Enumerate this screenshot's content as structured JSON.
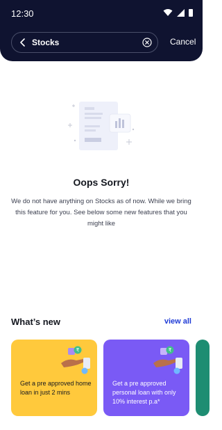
{
  "status_bar": {
    "time": "12:30"
  },
  "search": {
    "query": "Stocks",
    "cancel_label": "Cancel"
  },
  "empty_state": {
    "title": "Oops Sorry!",
    "description": "We do not have anything on Stocks as of now. While we bring this feature for you. See below some new features that you might like"
  },
  "whats_new": {
    "title": "What’s new",
    "view_all_label": "view all",
    "cards": [
      {
        "text": "Get a pre approved home loan in just 2 mins",
        "color": "#ffc93c"
      },
      {
        "text": "Get a pre approved personal loan with only 10% interest p.a*",
        "color": "#7a5af5"
      }
    ]
  },
  "colors": {
    "header": "#0f1330",
    "accent": "#1f3bd6",
    "third_card": "#1e8d72"
  }
}
